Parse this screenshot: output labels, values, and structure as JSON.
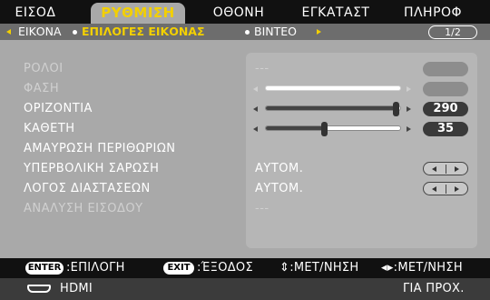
{
  "tabs": [
    {
      "label": "ΕΙΣΟΔ",
      "active": false
    },
    {
      "label": "ΡΥΘΜΙΣΗ",
      "active": true
    },
    {
      "label": "ΟΘΟΝΗ",
      "active": false
    },
    {
      "label": "ΕΓΚΑΤΑΣΤ",
      "active": false
    },
    {
      "label": "ΠΛΗΡΟΦ",
      "active": false
    }
  ],
  "subtabs": [
    {
      "label": "ΕΙΚΟΝΑ",
      "active": false
    },
    {
      "label": "ΕΠΙΛΟΓΕΣ ΕΙΚΟΝΑΣ",
      "active": true
    },
    {
      "label": "ΒΙΝΤΕΟ",
      "active": false
    }
  ],
  "page_indicator": "1/2",
  "rows": [
    {
      "label": "ΡΟΛΟΙ",
      "value": "---",
      "enabled": false
    },
    {
      "label": "ΦΑΣΗ",
      "enabled": false
    },
    {
      "label": "ΟΡΙΖΟΝΤΙΑ",
      "value": "290",
      "level": 0.97,
      "enabled": true
    },
    {
      "label": "ΚΑΘΕΤΗ",
      "value": "35",
      "level": 0.44,
      "enabled": true
    },
    {
      "label": "ΑΜΑΥΡΩΣΗ ΠΕΡΙΘΩΡΙΩΝ",
      "enabled": true
    },
    {
      "label": "ΥΠΕΡΒΟΛΙΚΗ ΣΑΡΩΣΗ",
      "value": "ΑΥΤΟΜ.",
      "enabled": true
    },
    {
      "label": "ΛΟΓΟΣ ΔΙΑΣΤΑΣΕΩΝ",
      "value": "ΑΥΤΟΜ.",
      "enabled": true
    },
    {
      "label": "ΑΝΑΛΥΣΗ ΕΙΣΟΔΟΥ",
      "value": "---",
      "enabled": false
    }
  ],
  "help": {
    "enter_key": "ENTER",
    "enter_text": ":ΕΠΙΛΟΓΗ",
    "exit_key": "EXIT",
    "exit_text": ":ΈΞΟΔΟΣ",
    "move_text": "⇕:ΜΕΤ/ΝΗΣΗ",
    "move_lr_text": "◂▸:ΜΕΤ/ΝΗΣΗ"
  },
  "status": {
    "source": "HDMI",
    "right": "ΓΙΑ ΠΡΟΧ."
  },
  "colors": {
    "accent": "#f3d000",
    "panel": "#a9a9a9",
    "bar": "#111111"
  }
}
